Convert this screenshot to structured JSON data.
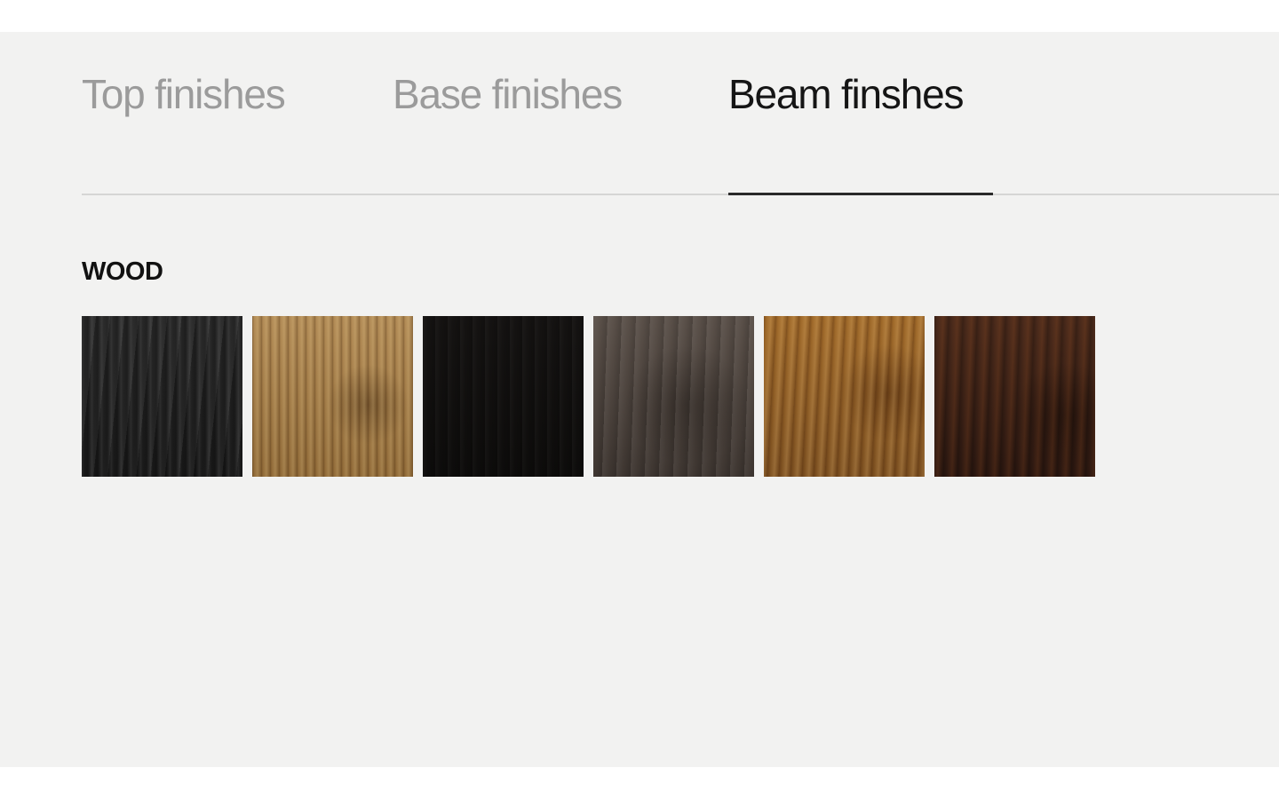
{
  "tabs": [
    {
      "label": "Top finishes",
      "active": false
    },
    {
      "label": "Base finishes",
      "active": false
    },
    {
      "label": "Beam finshes",
      "active": true
    }
  ],
  "section": {
    "title": "WOOD"
  },
  "swatches": [
    {
      "color": "#1f1f1f"
    },
    {
      "color": "#a07a48"
    },
    {
      "color": "#121110"
    },
    {
      "color": "#4d443e"
    },
    {
      "color": "#8f5f26"
    },
    {
      "color": "#3a2116"
    }
  ],
  "colors": {
    "panel_background": "#f2f2f1",
    "tab_inactive": "#9b9b9b",
    "tab_active": "#151515",
    "divider": "#d6d6d5",
    "active_underline": "#2a2a2a"
  }
}
